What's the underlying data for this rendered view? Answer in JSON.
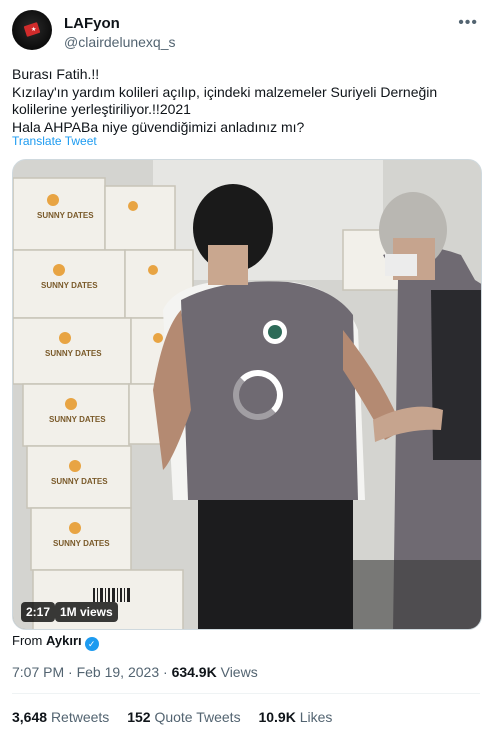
{
  "author": {
    "name": "LAFyon",
    "handle": "@clairdelunexq_s",
    "avatar_icon": "avatar-dark-flag"
  },
  "tweet": {
    "lines": [
      "Burası Fatih.!!",
      "Kızılay'ın yardım kolileri açılıp, içindeki malzemeler Suriyeli Derneğin",
      "kolilerine yerleştiriliyor.!!2021",
      "Hala AHPABa niye güvendiğimizi anladınız mı?"
    ],
    "translate_label": "Translate Tweet"
  },
  "video": {
    "duration": "2:17",
    "views": "1M views",
    "box_labels": [
      "SUNNY DATES",
      "SUNNY DATES",
      "SUNNY DATES",
      "SUNNY DATES",
      "SUNNY DATES",
      "SUNNY DATES"
    ]
  },
  "source": {
    "prefix": "From",
    "name": "Aykırı"
  },
  "meta": {
    "time": "7:07 PM",
    "date": "Feb 19, 2023",
    "views_count": "634.9K",
    "views_label": "Views"
  },
  "stats": {
    "retweets_count": "3,648",
    "retweets_label": "Retweets",
    "quotes_count": "152",
    "quotes_label": "Quote Tweets",
    "likes_count": "10.9K",
    "likes_label": "Likes"
  },
  "colors": {
    "accent": "#1d9bf0",
    "secondary_text": "#536471",
    "primary_text": "#0f1419"
  }
}
